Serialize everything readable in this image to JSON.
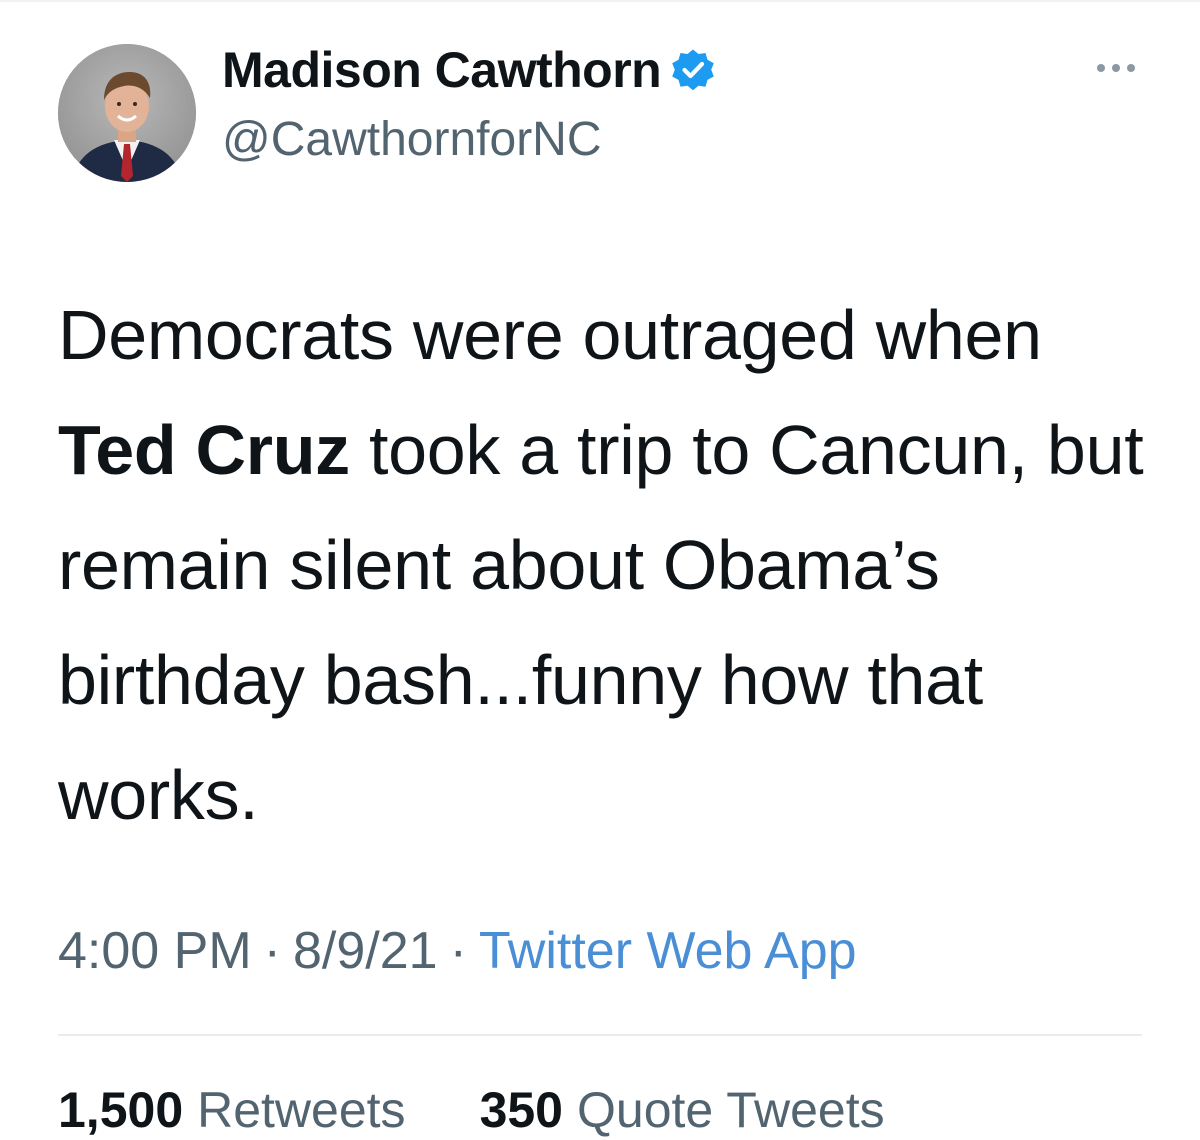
{
  "author": {
    "display_name": "Madison Cawthorn",
    "handle": "@CawthornforNC",
    "verified": true,
    "verified_badge_color": "#1d9bf0"
  },
  "tweet": {
    "text_before": "Democrats were outraged when ",
    "mention": "Ted Cruz",
    "text_after": " took a trip to Cancun, but remain silent about Obama’s birthday bash...funny how that works."
  },
  "meta": {
    "time": "4:00 PM",
    "separator": "·",
    "date": "8/9/21",
    "source": "Twitter Web App"
  },
  "stats": {
    "retweets_count": "1,500",
    "retweets_label": "Retweets",
    "quotes_count": "350",
    "quotes_label": "Quote Tweets"
  },
  "icons": {
    "verified": "verified-badge-icon",
    "more": "more-horizontal-icon"
  }
}
